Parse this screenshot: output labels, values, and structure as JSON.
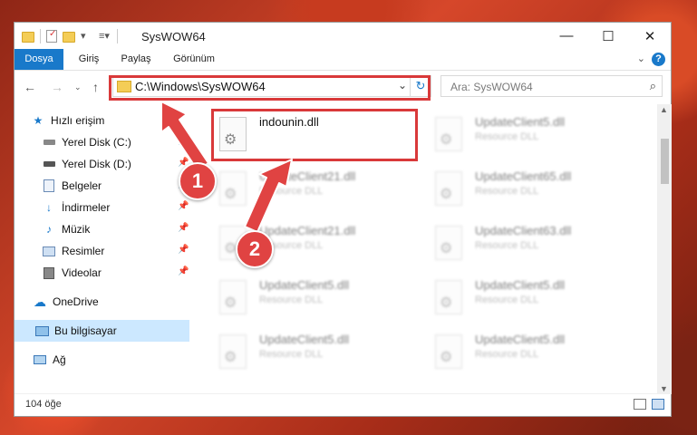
{
  "window": {
    "title": "SysWOW64",
    "ribbon_tabs": [
      "Dosya",
      "Giriş",
      "Paylaş",
      "Görünüm"
    ]
  },
  "address": {
    "path": "C:\\Windows\\SysWOW64",
    "search_placeholder": "Ara: SysWOW64"
  },
  "sidebar": {
    "items": [
      {
        "label": "Hızlı erişim",
        "icon": "star-icon"
      },
      {
        "label": "Yerel Disk (C:)",
        "icon": "drive-icon"
      },
      {
        "label": "Yerel Disk (D:)",
        "icon": "drive-icon"
      },
      {
        "label": "Belgeler",
        "icon": "documents-icon"
      },
      {
        "label": "İndirmeler",
        "icon": "download-icon"
      },
      {
        "label": "Müzik",
        "icon": "music-icon"
      },
      {
        "label": "Resimler",
        "icon": "pictures-icon"
      },
      {
        "label": "Videolar",
        "icon": "video-icon"
      },
      {
        "label": "OneDrive",
        "icon": "cloud-icon"
      },
      {
        "label": "Bu bilgisayar",
        "icon": "computer-icon"
      },
      {
        "label": "Ağ",
        "icon": "network-icon"
      }
    ]
  },
  "files": [
    {
      "name": "indounin.dll",
      "type": ""
    },
    {
      "name": "UpdateClient5.dll",
      "type": "Resource DLL"
    },
    {
      "name": "UpdateClient21.dll",
      "type": "Resource DLL"
    },
    {
      "name": "UpdateClient65.dll",
      "type": "Resource DLL"
    },
    {
      "name": "UpdateClient21.dll",
      "type": "Resource DLL"
    },
    {
      "name": "UpdateClient63.dll",
      "type": "Resource DLL"
    },
    {
      "name": "UpdateClient5.dll",
      "type": "Resource DLL"
    },
    {
      "name": "UpdateClient5.dll",
      "type": "Resource DLL"
    },
    {
      "name": "UpdateClient5.dll",
      "type": "Resource DLL"
    },
    {
      "name": "UpdateClient5.dll",
      "type": "Resource DLL"
    }
  ],
  "status": {
    "item_count": "104 öğe"
  },
  "callouts": [
    "1",
    "2"
  ],
  "colors": {
    "accent": "#1979ca",
    "highlight": "#d9393a",
    "selection": "#cce8ff"
  }
}
